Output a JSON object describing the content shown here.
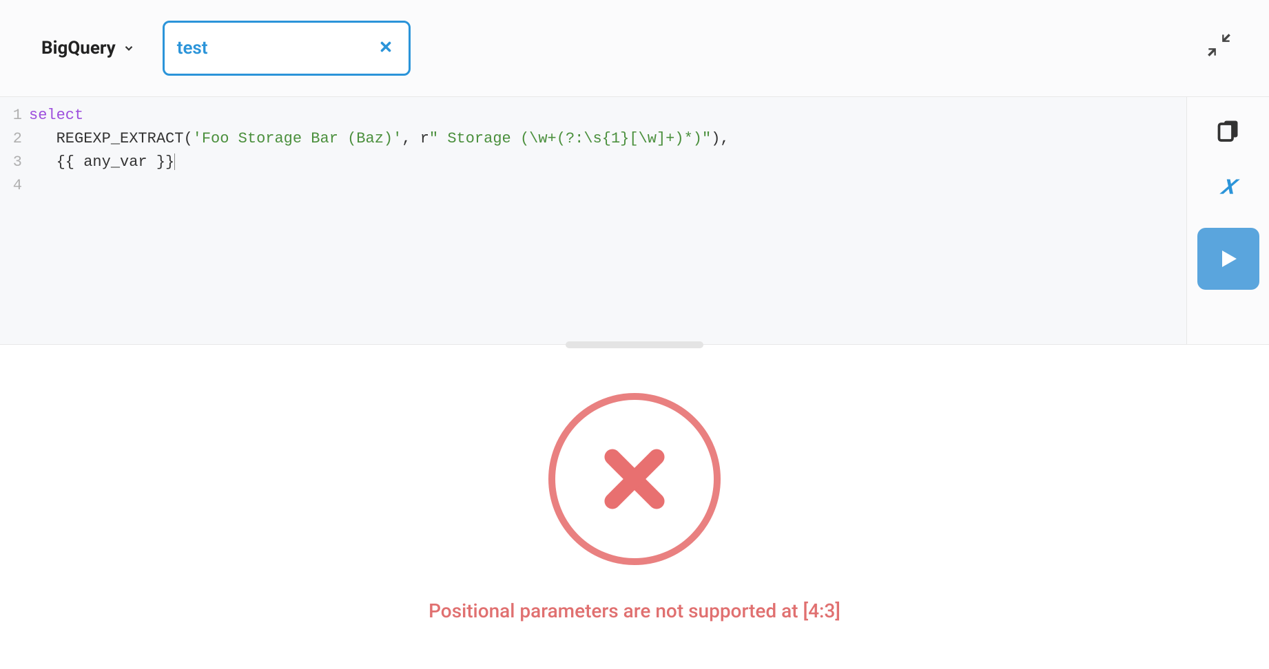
{
  "topbar": {
    "database_label": "BigQuery",
    "tag_text": "test"
  },
  "editor": {
    "line_numbers": [
      "1",
      "2",
      "3",
      "4"
    ],
    "lines": {
      "l1_kw": "select",
      "l2_indent": "   ",
      "l2_fn": "REGEXP_EXTRACT",
      "l2_paren_open": "(",
      "l2_str1": "'Foo Storage Bar (Baz)'",
      "l2_comma": ", ",
      "l2_rprefix": "r",
      "l2_str2": "\" Storage (\\w+(?:\\s{1}[\\w]+)*)\"",
      "l2_close": "),",
      "l3_indent": "   ",
      "l3_text": "{{ any_var }}",
      "l4": ""
    }
  },
  "error": {
    "message": "Positional parameters are not supported at [4:3]"
  }
}
